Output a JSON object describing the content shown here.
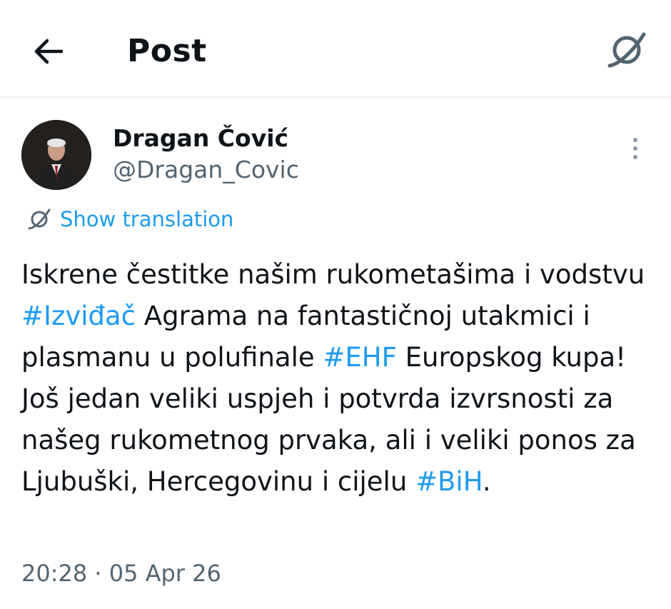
{
  "header": {
    "back_icon": "arrow-left-icon",
    "title": "Post",
    "translate_icon": "translate-icon"
  },
  "author": {
    "name": "Dragan Čović",
    "handle": "@Dragan_Covic",
    "avatar_icon": "avatar-photo"
  },
  "more_icon": "more-vertical-icon",
  "translation": {
    "label": "Show translation",
    "icon": "translate-icon"
  },
  "tweet": {
    "segments": [
      {
        "text": "Iskrene čestitke našim rukometašima i vodstvu ",
        "type": "text"
      },
      {
        "text": "#Izviđač",
        "type": "hashtag"
      },
      {
        "text": " Agrama na fantastičnoj utakmici i plasmanu u polufinale ",
        "type": "text"
      },
      {
        "text": "#EHF",
        "type": "hashtag"
      },
      {
        "text": " Europskog kupa! Još jedan veliki uspjeh i potvrda izvrsnosti za našeg rukometnog prvaka, ali i veliki ponos za Ljubuški, Hercegovinu i cijelu ",
        "type": "text"
      },
      {
        "text": "#BiH",
        "type": "hashtag"
      },
      {
        "text": ".",
        "type": "text"
      }
    ]
  },
  "timestamp": "20:28 · 05 Apr 26",
  "colors": {
    "link": "#1d9bf0",
    "secondary_text": "#536471",
    "primary_text": "#0f1419",
    "divider": "#eff3f4"
  }
}
